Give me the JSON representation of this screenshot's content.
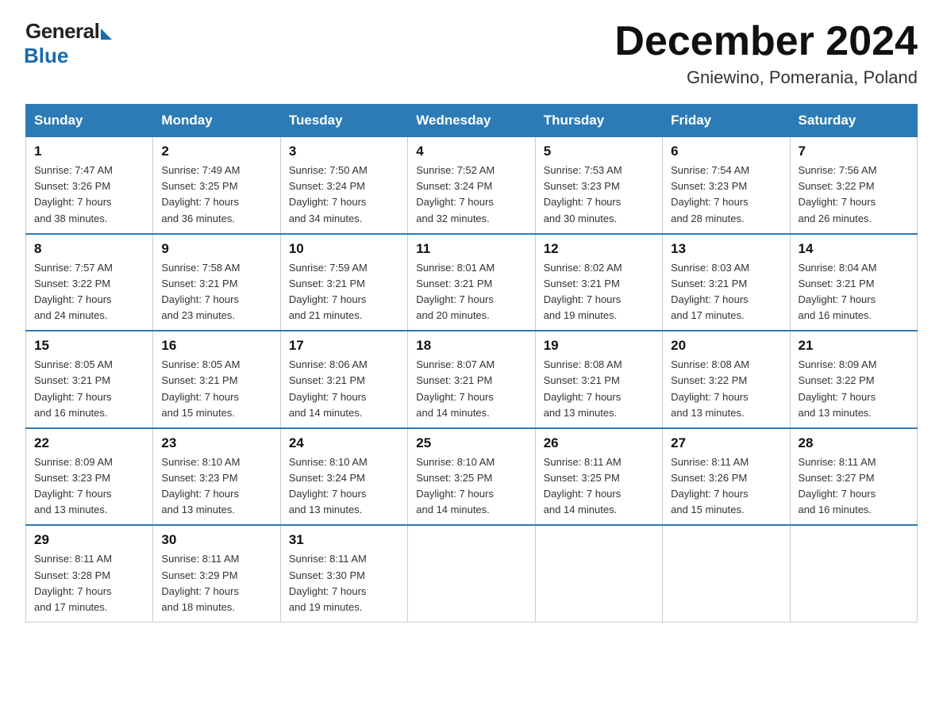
{
  "header": {
    "logo_general": "General",
    "logo_blue": "Blue",
    "month_title": "December 2024",
    "location": "Gniewino, Pomerania, Poland"
  },
  "weekdays": [
    "Sunday",
    "Monday",
    "Tuesday",
    "Wednesday",
    "Thursday",
    "Friday",
    "Saturday"
  ],
  "weeks": [
    [
      {
        "day": "1",
        "sunrise": "7:47 AM",
        "sunset": "3:26 PM",
        "daylight": "7 hours and 38 minutes."
      },
      {
        "day": "2",
        "sunrise": "7:49 AM",
        "sunset": "3:25 PM",
        "daylight": "7 hours and 36 minutes."
      },
      {
        "day": "3",
        "sunrise": "7:50 AM",
        "sunset": "3:24 PM",
        "daylight": "7 hours and 34 minutes."
      },
      {
        "day": "4",
        "sunrise": "7:52 AM",
        "sunset": "3:24 PM",
        "daylight": "7 hours and 32 minutes."
      },
      {
        "day": "5",
        "sunrise": "7:53 AM",
        "sunset": "3:23 PM",
        "daylight": "7 hours and 30 minutes."
      },
      {
        "day": "6",
        "sunrise": "7:54 AM",
        "sunset": "3:23 PM",
        "daylight": "7 hours and 28 minutes."
      },
      {
        "day": "7",
        "sunrise": "7:56 AM",
        "sunset": "3:22 PM",
        "daylight": "7 hours and 26 minutes."
      }
    ],
    [
      {
        "day": "8",
        "sunrise": "7:57 AM",
        "sunset": "3:22 PM",
        "daylight": "7 hours and 24 minutes."
      },
      {
        "day": "9",
        "sunrise": "7:58 AM",
        "sunset": "3:21 PM",
        "daylight": "7 hours and 23 minutes."
      },
      {
        "day": "10",
        "sunrise": "7:59 AM",
        "sunset": "3:21 PM",
        "daylight": "7 hours and 21 minutes."
      },
      {
        "day": "11",
        "sunrise": "8:01 AM",
        "sunset": "3:21 PM",
        "daylight": "7 hours and 20 minutes."
      },
      {
        "day": "12",
        "sunrise": "8:02 AM",
        "sunset": "3:21 PM",
        "daylight": "7 hours and 19 minutes."
      },
      {
        "day": "13",
        "sunrise": "8:03 AM",
        "sunset": "3:21 PM",
        "daylight": "7 hours and 17 minutes."
      },
      {
        "day": "14",
        "sunrise": "8:04 AM",
        "sunset": "3:21 PM",
        "daylight": "7 hours and 16 minutes."
      }
    ],
    [
      {
        "day": "15",
        "sunrise": "8:05 AM",
        "sunset": "3:21 PM",
        "daylight": "7 hours and 16 minutes."
      },
      {
        "day": "16",
        "sunrise": "8:05 AM",
        "sunset": "3:21 PM",
        "daylight": "7 hours and 15 minutes."
      },
      {
        "day": "17",
        "sunrise": "8:06 AM",
        "sunset": "3:21 PM",
        "daylight": "7 hours and 14 minutes."
      },
      {
        "day": "18",
        "sunrise": "8:07 AM",
        "sunset": "3:21 PM",
        "daylight": "7 hours and 14 minutes."
      },
      {
        "day": "19",
        "sunrise": "8:08 AM",
        "sunset": "3:21 PM",
        "daylight": "7 hours and 13 minutes."
      },
      {
        "day": "20",
        "sunrise": "8:08 AM",
        "sunset": "3:22 PM",
        "daylight": "7 hours and 13 minutes."
      },
      {
        "day": "21",
        "sunrise": "8:09 AM",
        "sunset": "3:22 PM",
        "daylight": "7 hours and 13 minutes."
      }
    ],
    [
      {
        "day": "22",
        "sunrise": "8:09 AM",
        "sunset": "3:23 PM",
        "daylight": "7 hours and 13 minutes."
      },
      {
        "day": "23",
        "sunrise": "8:10 AM",
        "sunset": "3:23 PM",
        "daylight": "7 hours and 13 minutes."
      },
      {
        "day": "24",
        "sunrise": "8:10 AM",
        "sunset": "3:24 PM",
        "daylight": "7 hours and 13 minutes."
      },
      {
        "day": "25",
        "sunrise": "8:10 AM",
        "sunset": "3:25 PM",
        "daylight": "7 hours and 14 minutes."
      },
      {
        "day": "26",
        "sunrise": "8:11 AM",
        "sunset": "3:25 PM",
        "daylight": "7 hours and 14 minutes."
      },
      {
        "day": "27",
        "sunrise": "8:11 AM",
        "sunset": "3:26 PM",
        "daylight": "7 hours and 15 minutes."
      },
      {
        "day": "28",
        "sunrise": "8:11 AM",
        "sunset": "3:27 PM",
        "daylight": "7 hours and 16 minutes."
      }
    ],
    [
      {
        "day": "29",
        "sunrise": "8:11 AM",
        "sunset": "3:28 PM",
        "daylight": "7 hours and 17 minutes."
      },
      {
        "day": "30",
        "sunrise": "8:11 AM",
        "sunset": "3:29 PM",
        "daylight": "7 hours and 18 minutes."
      },
      {
        "day": "31",
        "sunrise": "8:11 AM",
        "sunset": "3:30 PM",
        "daylight": "7 hours and 19 minutes."
      },
      null,
      null,
      null,
      null
    ]
  ],
  "labels": {
    "sunrise": "Sunrise:",
    "sunset": "Sunset:",
    "daylight": "Daylight:"
  }
}
